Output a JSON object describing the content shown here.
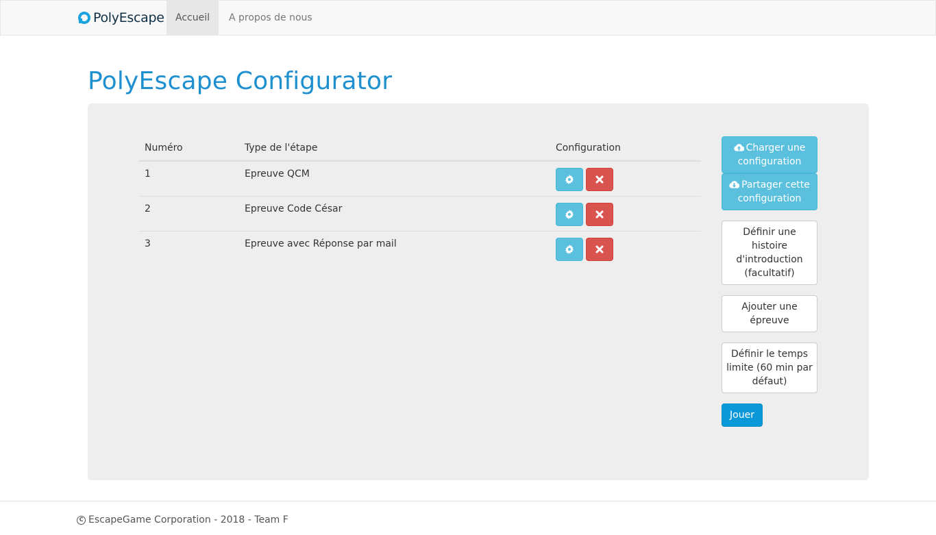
{
  "navbar": {
    "brand": "PolyEscape",
    "brand_icon": "polyescape-logo-icon",
    "items": [
      {
        "label": "Accueil",
        "active": true
      },
      {
        "label": "A propos de nous",
        "active": false
      }
    ]
  },
  "page": {
    "title": "PolyEscape Configurator"
  },
  "table": {
    "headers": [
      "Numéro",
      "Type de l'étape",
      "Configuration"
    ],
    "rows": [
      {
        "numero": "1",
        "type": "Epreuve QCM"
      },
      {
        "numero": "2",
        "type": "Epreuve Code César"
      },
      {
        "numero": "3",
        "type": "Epreuve avec Réponse par mail"
      }
    ],
    "row_actions": {
      "configure_icon": "gear-icon",
      "delete_icon": "close-icon"
    }
  },
  "sidebar": {
    "load_config": "Charger une configuration",
    "share_config": "Partager cette configuration",
    "define_intro": "Définir une histoire d'introduction (facultatif)",
    "add_step": "Ajouter une épreuve",
    "define_time": "Définir le temps limite (60 min par défaut)",
    "play": "Jouer",
    "load_icon": "cloud-upload-icon",
    "share_icon": "cloud-download-icon"
  },
  "footer": {
    "icon": "copyright-icon",
    "text": "EscapeGame Corporation - 2018 - Team F"
  },
  "colors": {
    "brand_blue": "#1e90d0",
    "info": "#5bc0de",
    "danger": "#d9534f",
    "primary": "#0a98d8",
    "panel": "#eeeeee"
  }
}
